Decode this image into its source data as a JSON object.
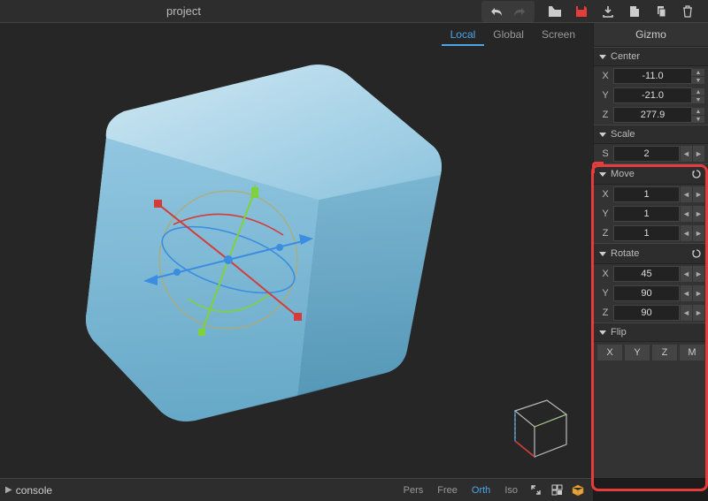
{
  "app": {
    "title": "project"
  },
  "viewport": {
    "tabs": {
      "local": "Local",
      "global": "Global",
      "screen": "Screen",
      "active": "local"
    },
    "modes": {
      "pers": "Pers",
      "free": "Free",
      "orth": "Orth",
      "iso": "Iso",
      "active": "orth"
    }
  },
  "console": {
    "label": "console"
  },
  "panel": {
    "title": "Gizmo",
    "center": {
      "label": "Center",
      "x_label": "X",
      "x": "-11.0",
      "y_label": "Y",
      "y": "-21.0",
      "z_label": "Z",
      "z": "277.9"
    },
    "scale": {
      "label": "Scale",
      "s_label": "S",
      "s": "2"
    },
    "move": {
      "label": "Move",
      "x_label": "X",
      "x": "1",
      "y_label": "Y",
      "y": "1",
      "z_label": "Z",
      "z": "1"
    },
    "rotate": {
      "label": "Rotate",
      "x_label": "X",
      "x": "45",
      "y_label": "Y",
      "y": "90",
      "z_label": "Z",
      "z": "90"
    },
    "flip": {
      "label": "Flip",
      "x": "X",
      "y": "Y",
      "z": "Z",
      "m": "M"
    }
  },
  "icons": {
    "undo": "undo",
    "redo": "redo",
    "open": "open",
    "save": "save",
    "download": "download",
    "newdoc": "new",
    "copy": "copy",
    "trash": "delete"
  }
}
